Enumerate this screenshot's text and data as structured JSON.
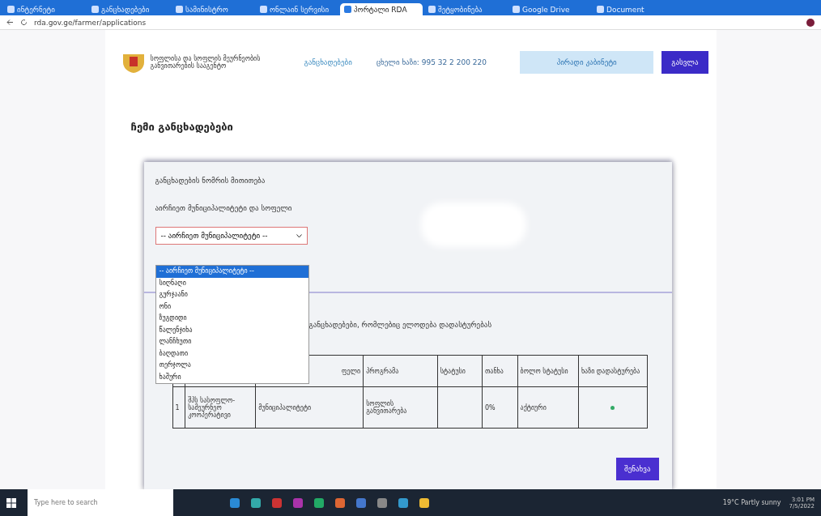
{
  "browser": {
    "tabs": [
      {
        "title": "ინტერნეტი",
        "selected": false
      },
      {
        "title": "განცხადებები",
        "selected": false
      },
      {
        "title": "სამინისტრო",
        "selected": false
      },
      {
        "title": "ონლაინ სერვისი",
        "selected": false
      },
      {
        "title": "პორტალი RDA",
        "selected": true
      },
      {
        "title": "შეტყობინება",
        "selected": false
      },
      {
        "title": "Google Drive",
        "selected": false
      },
      {
        "title": "Document",
        "selected": false
      }
    ],
    "url": "rda.gov.ge/farmer/applications"
  },
  "header": {
    "org_name": "სოფლისა და სოფლის მეურნეობის განვითარების სააგენტო",
    "nav_link": "განცხადებები",
    "hotline": "ცხელი ხაზი: 995 32 2 200 220",
    "cabinet_button": "პირადი კაბინეტი",
    "logout_button": "გასვლა"
  },
  "page_title": "ჩემი განცხადებები",
  "card": {
    "intro": "განცხადების ნომრის მითითება",
    "select_label": "აირჩიეთ მუნიციპალიტეტი და სოფელი",
    "select": {
      "value": "-- აირჩიეთ მუნიციპალიტეტი --",
      "expanded": true,
      "options": [
        {
          "label": "-- აირჩიეთ მუნიციპალიტეტი --",
          "selected": true
        },
        {
          "label": "სიღნაღი",
          "selected": false
        },
        {
          "label": "გურჯაანი",
          "selected": false
        },
        {
          "label": "ონი",
          "selected": false
        },
        {
          "label": "ზუგდიდი",
          "selected": false
        },
        {
          "label": "წალენჯიხა",
          "selected": false
        },
        {
          "label": "ლანჩხუთი",
          "selected": false
        },
        {
          "label": "ბაღდათი",
          "selected": false
        },
        {
          "label": "თერჯოლა",
          "selected": false
        },
        {
          "label": "ხაშური",
          "selected": false
        }
      ]
    },
    "table_caption": "განცხადებები, რომლებიც ელოდება დადასტურებას",
    "table": {
      "columns": [
        "",
        "",
        "ფელი",
        "პროგრამა",
        "სტატუსი",
        "თანხა",
        "ბოლო სტატუსი",
        "ხაზი დადასტურება"
      ],
      "rows": [
        {
          "cells": [
            "1",
            "შპს სასოფლო-სამეურნეო კოოპერატივი",
            "მუნიციპალიტეტი",
            "სოფლის განვითარება",
            "",
            "0%",
            "აქტიური"
          ],
          "confirmed": true
        }
      ]
    },
    "save_button": "შენახვა"
  },
  "taskbar": {
    "search_placeholder": "Type here to search",
    "weather": "19°C Partly sunny",
    "time": "3:01 PM",
    "date": "7/5/2022"
  }
}
